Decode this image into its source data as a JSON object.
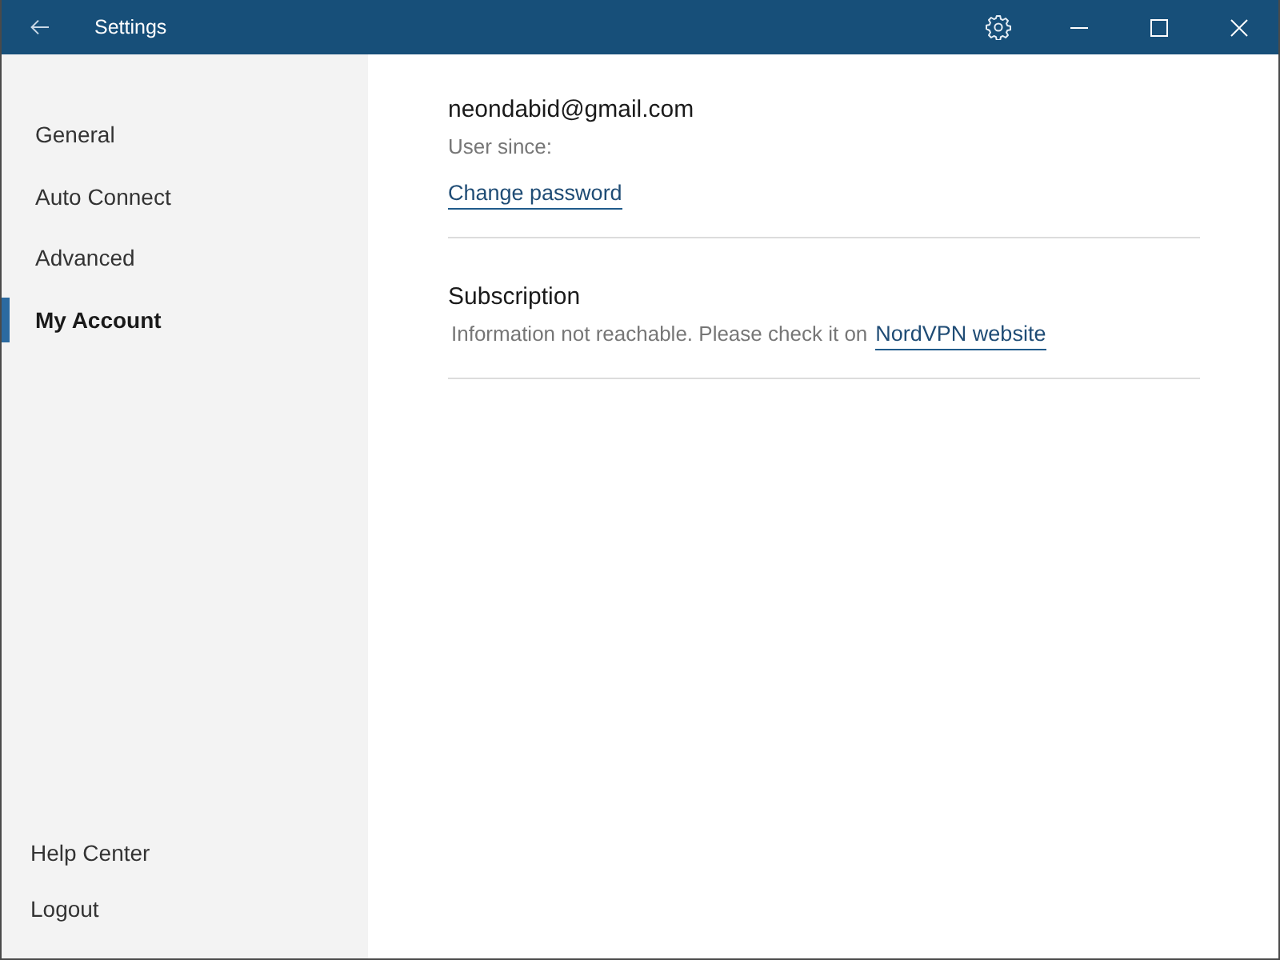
{
  "window": {
    "title": "Settings"
  },
  "sidebar": {
    "items": [
      {
        "label": "General",
        "selected": false
      },
      {
        "label": "Auto Connect",
        "selected": false
      },
      {
        "label": "Advanced",
        "selected": false
      },
      {
        "label": "My Account",
        "selected": true
      }
    ],
    "footer_items": [
      {
        "label": "Help Center"
      },
      {
        "label": "Logout"
      }
    ]
  },
  "account": {
    "email": "neondabid@gmail.com",
    "user_since": "User since:",
    "change_password": "Change password"
  },
  "subscription": {
    "heading": "Subscription",
    "message": "Information not reachable. Please check it on",
    "link": "NordVPN website"
  }
}
